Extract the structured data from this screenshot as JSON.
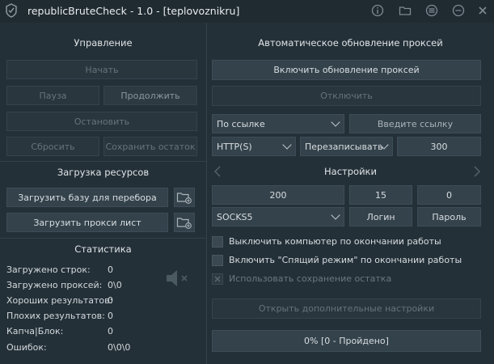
{
  "window": {
    "title": "republicBruteCheck - 1.0 - [teplovoznikru]"
  },
  "control": {
    "title": "Управление",
    "start": "Начать",
    "pause": "Пауза",
    "resume": "Продолжить",
    "stop": "Остановить",
    "reset": "Сбросить",
    "save_rest": "Сохранить остаток"
  },
  "resources": {
    "title": "Загрузка ресурсов",
    "load_base": "Загрузить базу для перебора",
    "load_proxies": "Загрузить прокси лист"
  },
  "stats": {
    "title": "Статистика",
    "rows": [
      {
        "label": "Загружено строк:",
        "value": "0"
      },
      {
        "label": "Загружено проксей:",
        "value": "0\\0"
      },
      {
        "label": "Хороших результатов:",
        "value": "0"
      },
      {
        "label": "Плохих результатов:",
        "value": "0"
      },
      {
        "label": "Капча|Блок:",
        "value": "0"
      },
      {
        "label": "Ошибок:",
        "value": "0\\0\\0"
      }
    ]
  },
  "proxy_update": {
    "title": "Автоматическое обновление проксей",
    "enable": "Включить обновление проксей",
    "disable": "Отключить",
    "source": "По ссылке",
    "url_placeholder": "Введите ссылку",
    "proxy_type": "HTTP(S)",
    "mode": "Перезаписывать",
    "interval": "300"
  },
  "settings": {
    "title": "Настройки",
    "field1": "200",
    "field2": "15",
    "field3": "0",
    "protocol": "SOCKS5",
    "login": "Логин",
    "password": "Пароль",
    "option_shutdown": "Выключить компьютер по окончании работы",
    "option_sleep": "Включить \"Спящий режим\" по окончании работы",
    "option_save_rest": "Использовать сохранение остатка",
    "more_settings": "Открыть дополнительные настройки",
    "progress": "0% [0 - Пройдено]"
  },
  "colors": {
    "background": "#243038",
    "titlebar": "#202a31",
    "button": "#2d3a42",
    "field": "#34424b"
  }
}
